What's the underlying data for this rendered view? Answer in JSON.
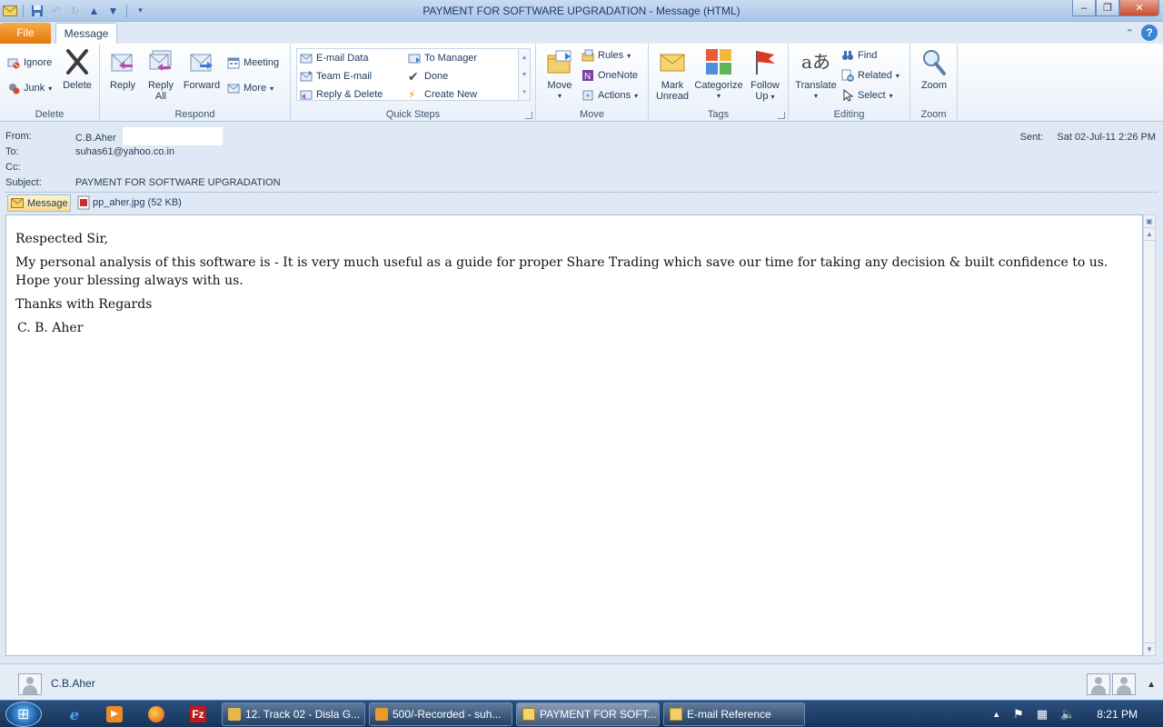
{
  "window": {
    "title": "PAYMENT FOR SOFTWARE UPGRADATION  -  Message (HTML)"
  },
  "tabs": {
    "file": "File",
    "message": "Message"
  },
  "ribbon": {
    "delete_group": {
      "label": "Delete",
      "ignore": "Ignore",
      "junk": "Junk",
      "delete": "Delete"
    },
    "respond_group": {
      "label": "Respond",
      "reply": "Reply",
      "reply_all_1": "Reply",
      "reply_all_2": "All",
      "forward": "Forward",
      "meeting": "Meeting",
      "more": "More"
    },
    "quick_steps_group": {
      "label": "Quick Steps",
      "items": [
        "E-mail Data",
        "Team E-mail",
        "Reply & Delete",
        "To Manager",
        "Done",
        "Create New"
      ]
    },
    "move_group": {
      "label": "Move",
      "move": "Move",
      "rules": "Rules",
      "onenote": "OneNote",
      "actions": "Actions"
    },
    "tags_group": {
      "label": "Tags",
      "mark_unread_1": "Mark",
      "mark_unread_2": "Unread",
      "categorize": "Categorize",
      "follow_up_1": "Follow",
      "follow_up_2": "Up"
    },
    "editing_group": {
      "label": "Editing",
      "translate": "Translate",
      "find": "Find",
      "related": "Related",
      "select": "Select"
    },
    "zoom_group": {
      "label": "Zoom",
      "zoom": "Zoom"
    }
  },
  "header": {
    "from_label": "From:",
    "from_value": "C.B.Aher",
    "to_label": "To:",
    "to_value": "suhas61@yahoo.co.in",
    "cc_label": "Cc:",
    "cc_value": "",
    "subject_label": "Subject:",
    "subject_value": "PAYMENT FOR SOFTWARE UPGRADATION",
    "sent_label": "Sent:",
    "sent_value": "Sat 02-Jul-11 2:26 PM"
  },
  "attachments": {
    "message_button": "Message",
    "file": "pp_aher.jpg (52 KB)"
  },
  "body": {
    "greeting": "Respected Sir,",
    "paragraph": "My personal analysis of this software is - It is very much useful as a guide for proper Share Trading which save our time for taking any decision & built confidence to us. Hope your blessing always with us.",
    "closing": "Thanks with Regards",
    "signature": "C. B. Aher"
  },
  "people_pane": {
    "name": "C.B.Aher"
  },
  "taskbar": {
    "tasks": [
      "12. Track 02 - Disla G...",
      "500/-Recorded - suh...",
      "PAYMENT FOR SOFT...",
      "E-mail Reference"
    ],
    "clock": "8:21 PM"
  }
}
